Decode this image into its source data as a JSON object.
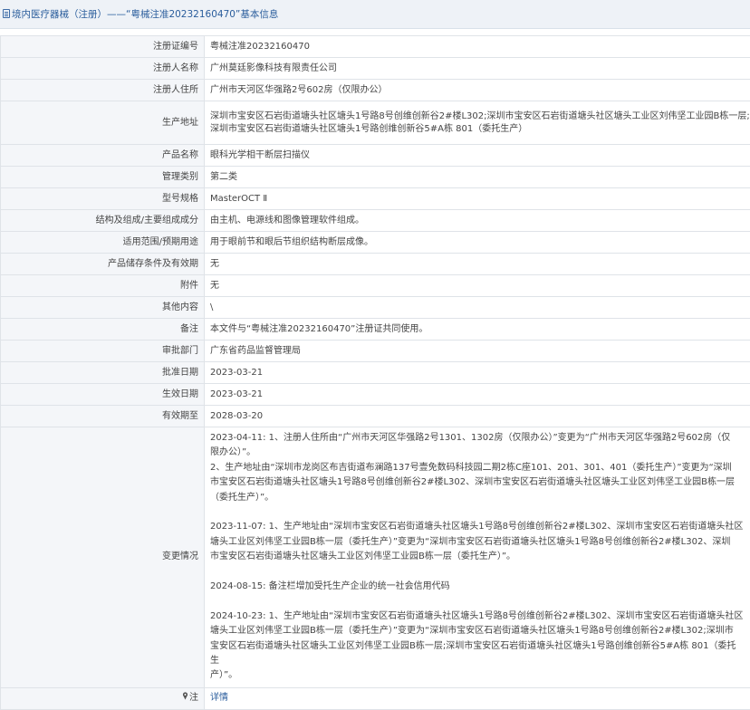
{
  "header": {
    "title": "境内医疗器械（注册）——“粤械注准20232160470”基本信息"
  },
  "rows": {
    "reg_no": {
      "label": "注册证编号",
      "value": "粤械注准20232160470"
    },
    "registrant": {
      "label": "注册人名称",
      "value": "广州莫廷影像科技有限责任公司"
    },
    "residence": {
      "label": "注册人住所",
      "value": "广州市天河区华强路2号602房（仅限办公）"
    },
    "production_address": {
      "label": "生产地址",
      "value_line1": "深圳市宝安区石岩街道塘头社区塘头1号路8号创维创新谷2#楼L302;深圳市宝安区石岩街道塘头社区塘头工业区刘伟坚工业园B栋一层;",
      "value_line2": "深圳市宝安区石岩街道塘头社区塘头1号路创维创新谷5#A栋 801（委托生产）"
    },
    "product_name": {
      "label": "产品名称",
      "value": "眼科光学相干断层扫描仪"
    },
    "management_class": {
      "label": "管理类别",
      "value": "第二类"
    },
    "model": {
      "label": "型号规格",
      "value": "MasterOCT Ⅱ"
    },
    "structure": {
      "label": "结构及组成/主要组成成分",
      "value": "由主机、电源线和图像管理软件组成。"
    },
    "intended_use": {
      "label": "适用范围/预期用途",
      "value": "用于眼前节和眼后节组织结构断层成像。"
    },
    "storage": {
      "label": "产品储存条件及有效期",
      "value": "无"
    },
    "attachment": {
      "label": "附件",
      "value": "无"
    },
    "other": {
      "label": "其他内容",
      "value": "\\"
    },
    "remark": {
      "label": "备注",
      "value": "本文件与“粤械注准20232160470”注册证共同使用。"
    },
    "approval_dept": {
      "label": "审批部门",
      "value": "广东省药品监督管理局"
    },
    "approval_date": {
      "label": "批准日期",
      "value": "2023-03-21"
    },
    "effective_date": {
      "label": "生效日期",
      "value": "2023-03-21"
    },
    "expiry_date": {
      "label": "有效期至",
      "value": "2028-03-20"
    },
    "changes": {
      "label": "变更情况",
      "lines": [
        "2023-04-11: 1、注册人住所由“广州市天河区华强路2号1301、1302房（仅限办公）”变更为“广州市天河区华强路2号602房（仅",
        "限办公）”。",
        "2、生产地址由“深圳市龙岗区布吉街道布澜路137号壹免数码科技园二期2栋C座101、201、301、401（委托生产）”变更为“深圳",
        "市宝安区石岩街道塘头社区塘头1号路8号创维创新谷2#楼L302、深圳市宝安区石岩街道塘头社区塘头工业区刘伟坚工业园B栋一层",
        "（委托生产）”。",
        "",
        "2023-11-07: 1、生产地址由“深圳市宝安区石岩街道塘头社区塘头1号路8号创维创新谷2#楼L302、深圳市宝安区石岩街道塘头社区",
        "塘头工业区刘伟坚工业园B栋一层（委托生产）”变更为“深圳市宝安区石岩街道塘头社区塘头1号路8号创维创新谷2#楼L302、深圳",
        "市宝安区石岩街道塘头社区塘头工业区刘伟坚工业园B栋一层（委托生产）”。",
        "",
        "2024-08-15: 备注栏增加受托生产企业的统一社会信用代码",
        "",
        "2024-10-23: 1、生产地址由“深圳市宝安区石岩街道塘头社区塘头1号路8号创维创新谷2#楼L302、深圳市宝安区石岩街道塘头社区",
        "塘头工业区刘伟坚工业园B栋一层（委托生产）”变更为“深圳市宝安区石岩街道塘头社区塘头1号路8号创维创新谷2#楼L302;深圳市",
        "宝安区石岩街道塘头社区塘头工业区刘伟坚工业园B栋一层;深圳市宝安区石岩街道塘头社区塘头1号路创维创新谷5#A栋 801（委托生",
        "产）”。"
      ]
    },
    "note": {
      "label": "注",
      "value": "详情",
      "icon": "pin-icon"
    }
  }
}
